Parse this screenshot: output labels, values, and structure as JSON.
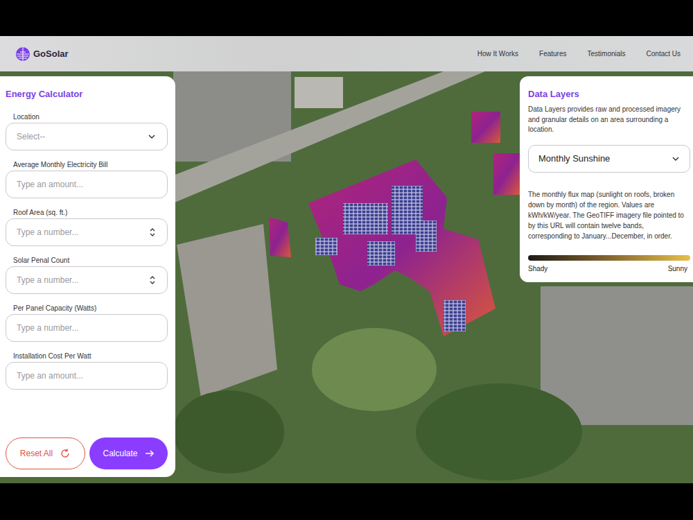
{
  "brand": {
    "name": "GoSolar"
  },
  "nav": [
    "How It Works",
    "Features",
    "Testimonials",
    "Contact Us"
  ],
  "calculator": {
    "title": "Energy Calculator",
    "fields": [
      {
        "label": "Location",
        "placeholder": "Select--",
        "kind": "select"
      },
      {
        "label": "Average Monthly Electricity Bill",
        "placeholder": "Type an amount...",
        "kind": "text"
      },
      {
        "label": "Roof Area (sq. ft.)",
        "placeholder": "Type a number...",
        "kind": "number"
      },
      {
        "label": "Solar Penal Count",
        "placeholder": "Type a number...",
        "kind": "number"
      },
      {
        "label": "Per Panel Capacity (Watts)",
        "placeholder": "Type a number...",
        "kind": "text"
      },
      {
        "label": "Installation Cost Per Watt",
        "placeholder": "Type an amount...",
        "kind": "text"
      }
    ],
    "reset": "Reset All",
    "calculate": "Calculate"
  },
  "layers": {
    "title": "Data Layers",
    "description": "Data Layers provides raw and processed imagery and granular details on an area surrounding a location.",
    "selected": "Monthly Sunshine",
    "info": "The monthly flux map (sunlight on roofs, broken down by month) of the region. Values are kWh/kW/year. The GeoTIFF imagery file pointed to by this URL will contain twelve bands, corresponding to January...December, in order.",
    "legend": {
      "low": "Shady",
      "high": "Sunny"
    }
  }
}
